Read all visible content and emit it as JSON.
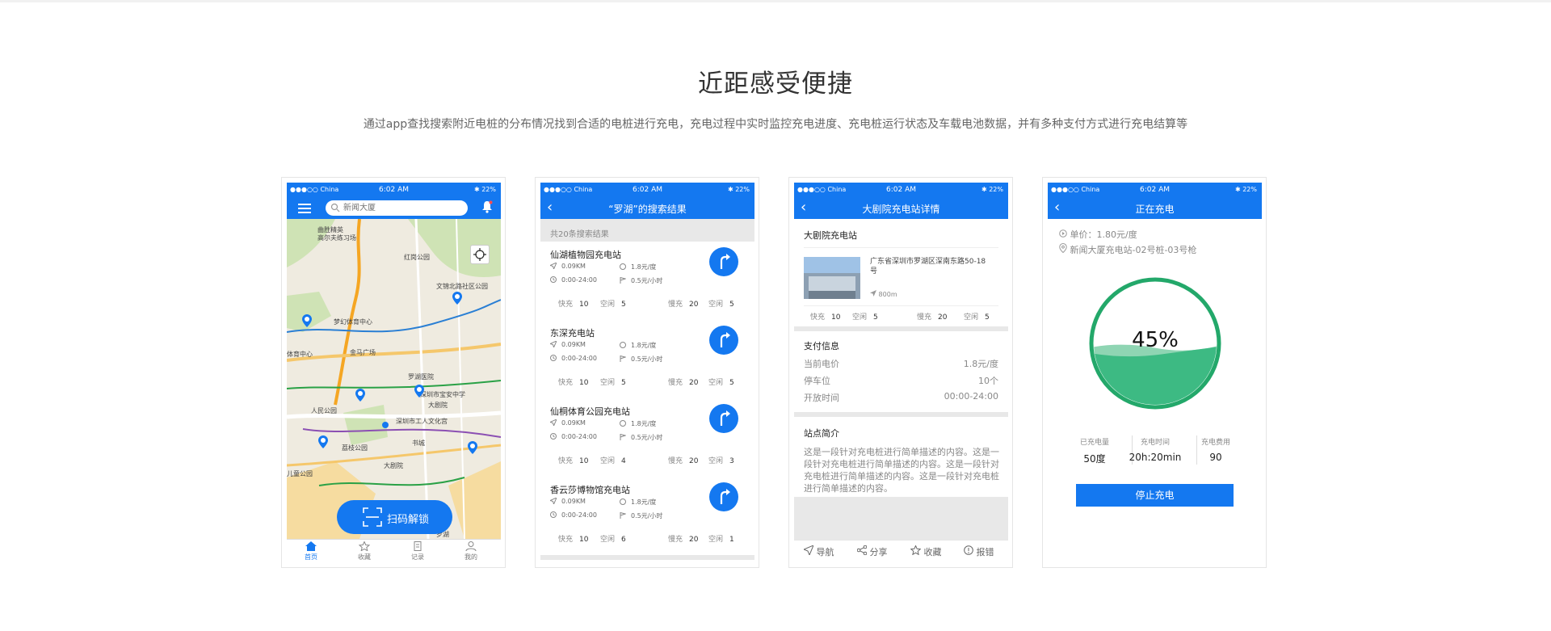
{
  "header": {
    "title": "近距感受便捷",
    "subtitle": "通过app查找搜索附近电桩的分布情况找到合适的电桩进行充电，充电过程中实时监控充电进度、充电桩运行状态及车载电池数据，并有多种支付方式进行充电结算等"
  },
  "statusbar": {
    "carrier": "●●●○○ China",
    "time": "6:02 AM",
    "battery": "✱ 22%"
  },
  "screen1": {
    "search_placeholder": "新闻大厦",
    "map_labels": [
      "曲胜精英",
      "高尔夫练习场",
      "红岗公园",
      "文锦北路社区公园",
      "梦幻体育中心",
      "体育中心",
      "金马广场",
      "罗湖医院",
      "深圳市宝安中学",
      "大剧院",
      "人民公园",
      "深圳市工人文化宫",
      "荔枝公园",
      "书城",
      "大剧院",
      "儿童公园",
      "罗湖"
    ],
    "unlock_label": "扫码解锁",
    "tabs": [
      "首页",
      "收藏",
      "记录",
      "我的"
    ]
  },
  "screen2": {
    "title": "“罗湖”的搜索结果",
    "count": "共20条搜索结果",
    "stations": [
      {
        "name": "仙湖植物园充电站",
        "distance": "0.09KM",
        "price": "1.8元/度",
        "hours": "0:00-24:00",
        "parking": "0.5元/小时",
        "fast_label": "快充",
        "fast": "10",
        "fast_free_label": "空闲",
        "fast_free": "5",
        "slow_label": "慢充",
        "slow": "20",
        "slow_free_label": "空闲",
        "slow_free": "5"
      },
      {
        "name": "东深充电站",
        "distance": "0.09KM",
        "price": "1.8元/度",
        "hours": "0:00-24:00",
        "parking": "0.5元/小时",
        "fast_label": "快充",
        "fast": "10",
        "fast_free_label": "空闲",
        "fast_free": "5",
        "slow_label": "慢充",
        "slow": "20",
        "slow_free_label": "空闲",
        "slow_free": "5"
      },
      {
        "name": "仙桐体育公园充电站",
        "distance": "0.09KM",
        "price": "1.8元/度",
        "hours": "0:00-24:00",
        "parking": "0.5元/小时",
        "fast_label": "快充",
        "fast": "10",
        "fast_free_label": "空闲",
        "fast_free": "4",
        "slow_label": "慢充",
        "slow": "20",
        "slow_free_label": "空闲",
        "slow_free": "3"
      },
      {
        "name": "香云莎博物馆充电站",
        "distance": "0.09KM",
        "price": "1.8元/度",
        "hours": "0:00-24:00",
        "parking": "0.5元/小时",
        "fast_label": "快充",
        "fast": "10",
        "fast_free_label": "空闲",
        "fast_free": "6",
        "slow_label": "慢充",
        "slow": "20",
        "slow_free_label": "空闲",
        "slow_free": "1"
      }
    ]
  },
  "screen3": {
    "title": "大剧院充电站详情",
    "station_name": "大剧院充电站",
    "address": "广东省深圳市罗湖区深南东路50-18号",
    "distance": "800m",
    "fast_label": "快充",
    "fast": "10",
    "fast_free_label": "空闲",
    "fast_free": "5",
    "slow_label": "慢充",
    "slow": "20",
    "slow_free_label": "空闲",
    "slow_free": "5",
    "pay_title": "支付信息",
    "price_label": "当前电价",
    "price": "1.8元/度",
    "parking_label": "停车位",
    "parking": "10个",
    "hours_label": "开放时间",
    "hours": "00:00-24:00",
    "intro_title": "站点简介",
    "intro": "这是一段针对充电桩进行简单描述的内容。这是一段针对充电桩进行简单描述的内容。这是一段针对充电桩进行简单描述的内容。这是一段针对充电桩进行简单描述的内容。",
    "actions": [
      "导航",
      "分享",
      "收藏",
      "报错"
    ]
  },
  "screen4": {
    "title": "正在充电",
    "unit_price": "单价：1.80元/度",
    "location": "新闻大厦充电站-02号桩-03号枪",
    "progress": "45%",
    "progress_value": 45,
    "stats": [
      {
        "label": "已充电量",
        "value": "50度"
      },
      {
        "label": "充电时间",
        "value": "20h:20min"
      },
      {
        "label": "充电费用",
        "value": "90"
      }
    ],
    "stop_label": "停止充电"
  },
  "colors": {
    "brand": "#1478f0",
    "green": "#23a86a",
    "water": "#3dba83"
  }
}
